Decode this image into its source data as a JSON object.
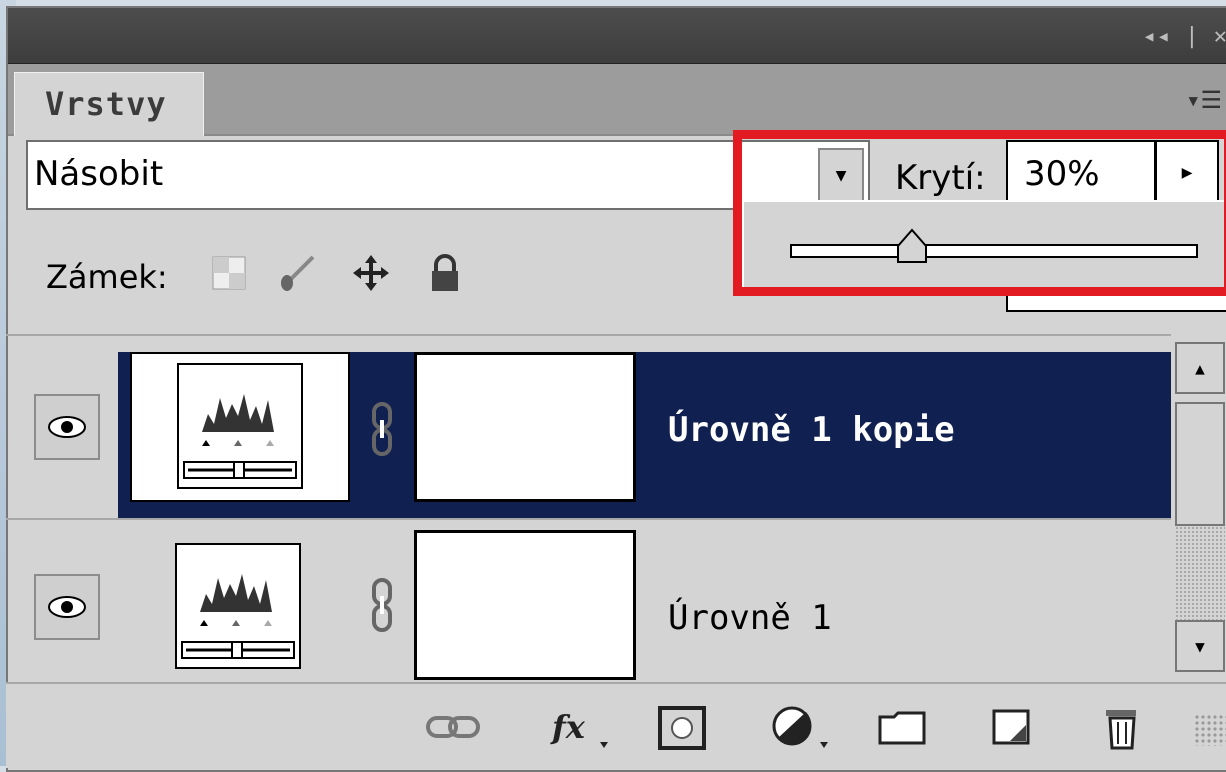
{
  "panel": {
    "title_controls": "◂◂ | ✕",
    "tab_label": "Vrstvy",
    "menu_icon": "panel-menu-icon"
  },
  "blend": {
    "mode": "Násobit"
  },
  "opacity": {
    "label": "Krytí:",
    "value": "30%",
    "slider_percent": 30
  },
  "lock": {
    "label": "Zámek:"
  },
  "layers": [
    {
      "name": "Úrovně 1 kopie",
      "selected": true,
      "visible": true
    },
    {
      "name": "Úrovně 1",
      "selected": false,
      "visible": true
    }
  ],
  "colors": {
    "selection": "#102050",
    "highlight": "#e21b22",
    "panel": "#d4d4d4"
  },
  "bottom_icons": [
    "link-icon",
    "fx-icon",
    "mask-icon",
    "adjustment-icon",
    "folder-icon",
    "new-layer-icon",
    "trash-icon"
  ]
}
